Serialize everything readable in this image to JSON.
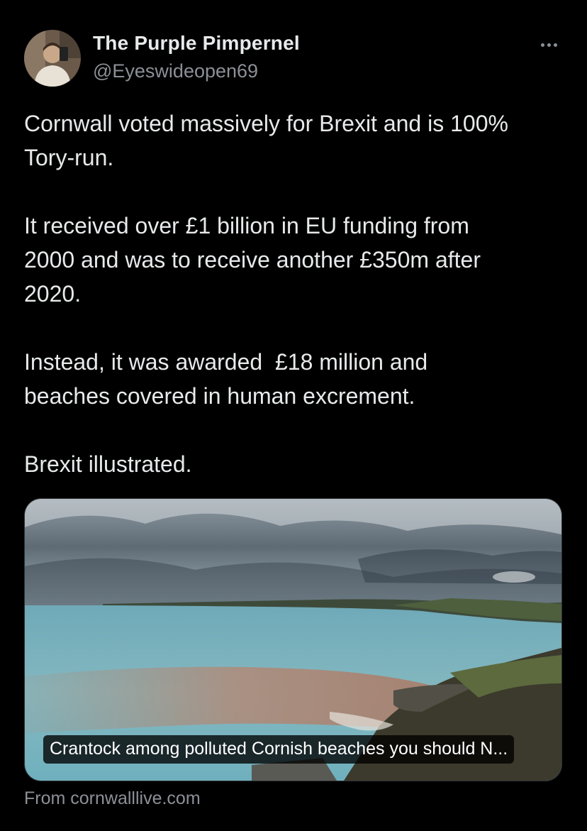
{
  "author": {
    "display_name": "The Purple Pimpernel",
    "handle": "@Eyeswideopen69"
  },
  "more_menu_icon": "more-horizontal-icon",
  "tweet": {
    "paragraphs": [
      "Cornwall voted massively for Brexit and is 100%\nTory-run.",
      "It received over £1 billion in EU funding from\n2000 and was to receive another £350m after\n2020.",
      "Instead, it was awarded  £18 million and\nbeaches covered in human excrement.",
      "Brexit illustrated."
    ]
  },
  "link_card": {
    "caption": "Crantock among polluted Cornish beaches you should N...",
    "source": "From cornwalllive.com"
  },
  "colors": {
    "background": "#000000",
    "text_primary": "#e7e9ea",
    "text_secondary": "#8b9097",
    "card_border": "#2f3336"
  }
}
